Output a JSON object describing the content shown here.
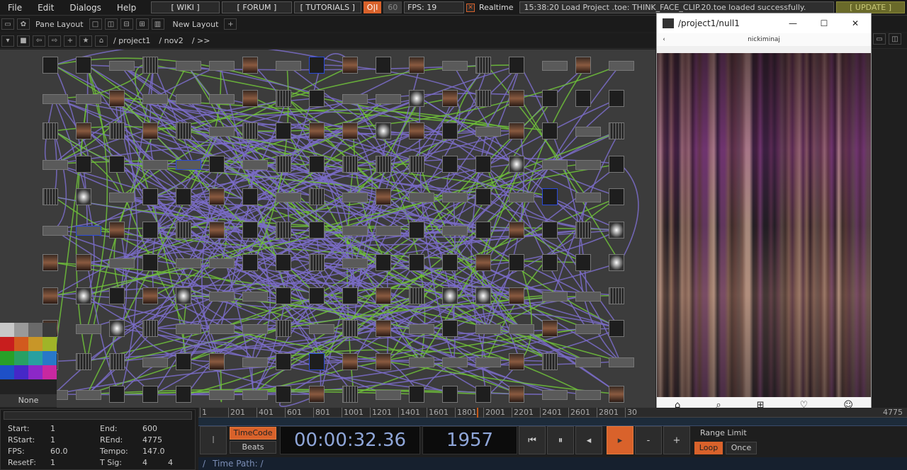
{
  "menu": [
    "File",
    "Edit",
    "Dialogs",
    "Help"
  ],
  "toolbar": {
    "wiki": "[ WIKI ]",
    "forum": "[ FORUM ]",
    "tutorials": "[ TUTORIALS ]",
    "oi": "O|I",
    "sixty": "60",
    "fps": "FPS:  19",
    "realtime": "Realtime",
    "message": "15:38:20 Load Project .toe: THINK_FACE_CLIP.20.toe loaded successfully.",
    "update": "[ UPDATE ]"
  },
  "pane": {
    "layout_label": "Pane Layout",
    "new_layout": "New Layout"
  },
  "path": {
    "crumbs": [
      "/ project1",
      "/ nov2",
      "/ >>"
    ]
  },
  "viewer": {
    "title": "/project1/null1",
    "username": "nickiminaj",
    "nav_icons": [
      "home-icon",
      "search-icon",
      "add-icon",
      "heart-icon",
      "profile-icon"
    ]
  },
  "palette": {
    "none": "None"
  },
  "timeline": {
    "ticks": [
      "1",
      "201",
      "401",
      "601",
      "801",
      "1001",
      "1201",
      "1401",
      "1601",
      "1801",
      "2001",
      "2201",
      "2401",
      "2601",
      "2801",
      "30",
      "4775"
    ],
    "current_frame": 1957,
    "end": 4775
  },
  "stats": {
    "start_label": "Start:",
    "start": "1",
    "end_label": "End:",
    "end": "600",
    "rstart_label": "RStart:",
    "rstart": "1",
    "rend_label": "REnd:",
    "rend": "4775",
    "fps_label": "FPS:",
    "fps": "60.0",
    "tempo_label": "Tempo:",
    "tempo": "147.0",
    "resetf_label": "ResetF:",
    "resetf": "1",
    "tsig_label": "T Sig:",
    "tsig_a": "4",
    "tsig_b": "4"
  },
  "controls": {
    "timecode": "TimeCode",
    "beats": "Beats",
    "time": "00:00:32.36",
    "frame": "1957",
    "range_limit": "Range Limit",
    "loop": "Loop",
    "once": "Once",
    "minus": "-",
    "plus": "+"
  },
  "timepath": "Time Path: /",
  "colors": {
    "accent": "#d9622b",
    "wire_purple": "#7a6cc8",
    "wire_green": "#6fbf3a",
    "network_bg": "#3c3c3c"
  }
}
